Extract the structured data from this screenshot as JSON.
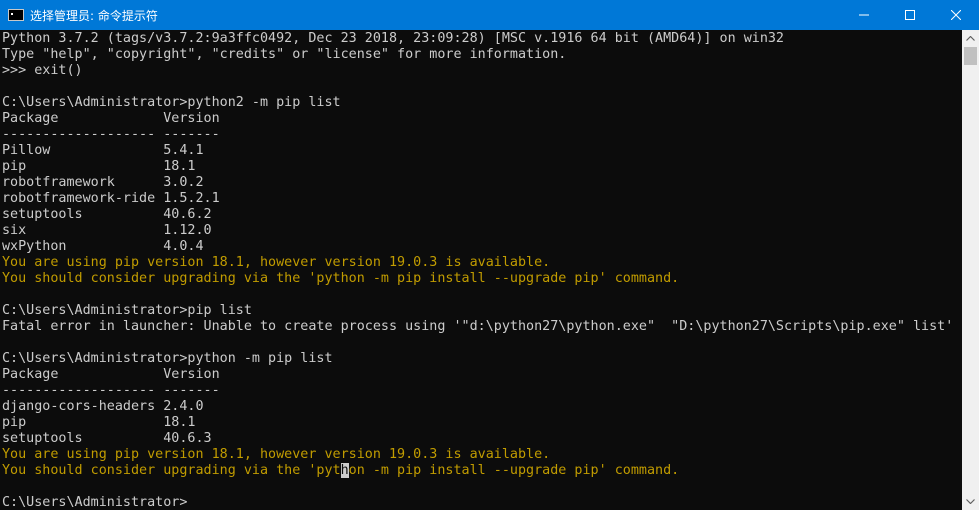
{
  "window": {
    "title": "选择管理员: 命令提示符"
  },
  "console": {
    "lines": [
      {
        "text": "Python 3.7.2 (tags/v3.7.2:9a3ffc0492, Dec 23 2018, 23:09:28) [MSC v.1916 64 bit (AMD64)] on win32",
        "style": "normal"
      },
      {
        "text": "Type \"help\", \"copyright\", \"credits\" or \"license\" for more information.",
        "style": "normal"
      },
      {
        "text": ">>> exit()",
        "style": "normal"
      },
      {
        "text": "",
        "style": "normal"
      },
      {
        "text": "C:\\Users\\Administrator>python2 -m pip list",
        "style": "normal"
      },
      {
        "text": "Package             Version",
        "style": "normal"
      },
      {
        "text": "------------------- -------",
        "style": "normal"
      },
      {
        "text": "Pillow              5.4.1",
        "style": "normal"
      },
      {
        "text": "pip                 18.1",
        "style": "normal"
      },
      {
        "text": "robotframework      3.0.2",
        "style": "normal"
      },
      {
        "text": "robotframework-ride 1.5.2.1",
        "style": "normal"
      },
      {
        "text": "setuptools          40.6.2",
        "style": "normal"
      },
      {
        "text": "six                 1.12.0",
        "style": "normal"
      },
      {
        "text": "wxPython            4.0.4",
        "style": "normal"
      },
      {
        "text": "You are using pip version 18.1, however version 19.0.3 is available.",
        "style": "warn"
      },
      {
        "text": "You should consider upgrading via the 'python -m pip install --upgrade pip' command.",
        "style": "warn"
      },
      {
        "text": "",
        "style": "normal"
      },
      {
        "text": "C:\\Users\\Administrator>pip list",
        "style": "normal"
      },
      {
        "text": "Fatal error in launcher: Unable to create process using '\"d:\\python27\\python.exe\"  \"D:\\python27\\Scripts\\pip.exe\" list'",
        "style": "normal"
      },
      {
        "text": "",
        "style": "normal"
      },
      {
        "text": "C:\\Users\\Administrator>python -m pip list",
        "style": "normal"
      },
      {
        "text": "Package             Version",
        "style": "normal"
      },
      {
        "text": "------------------- -------",
        "style": "normal"
      },
      {
        "text": "django-cors-headers 2.4.0",
        "style": "normal"
      },
      {
        "text": "pip                 18.1",
        "style": "normal"
      },
      {
        "text": "setuptools          40.6.3",
        "style": "normal"
      },
      {
        "text": "You are using pip version 18.1, however version 19.0.3 is available.",
        "style": "warn"
      },
      {
        "text": "You should consider upgrading via the 'python -m pip install --upgrade pip' command.",
        "style": "warn"
      },
      {
        "text": "",
        "style": "normal"
      },
      {
        "text": "C:\\Users\\Administrator>",
        "style": "normal"
      }
    ],
    "cursor": {
      "line": 27,
      "char": 42
    },
    "colors": {
      "background": "#0c0c0c",
      "foreground": "#cccccc",
      "warning": "#c19c00",
      "titlebar": "#0078d7"
    }
  }
}
